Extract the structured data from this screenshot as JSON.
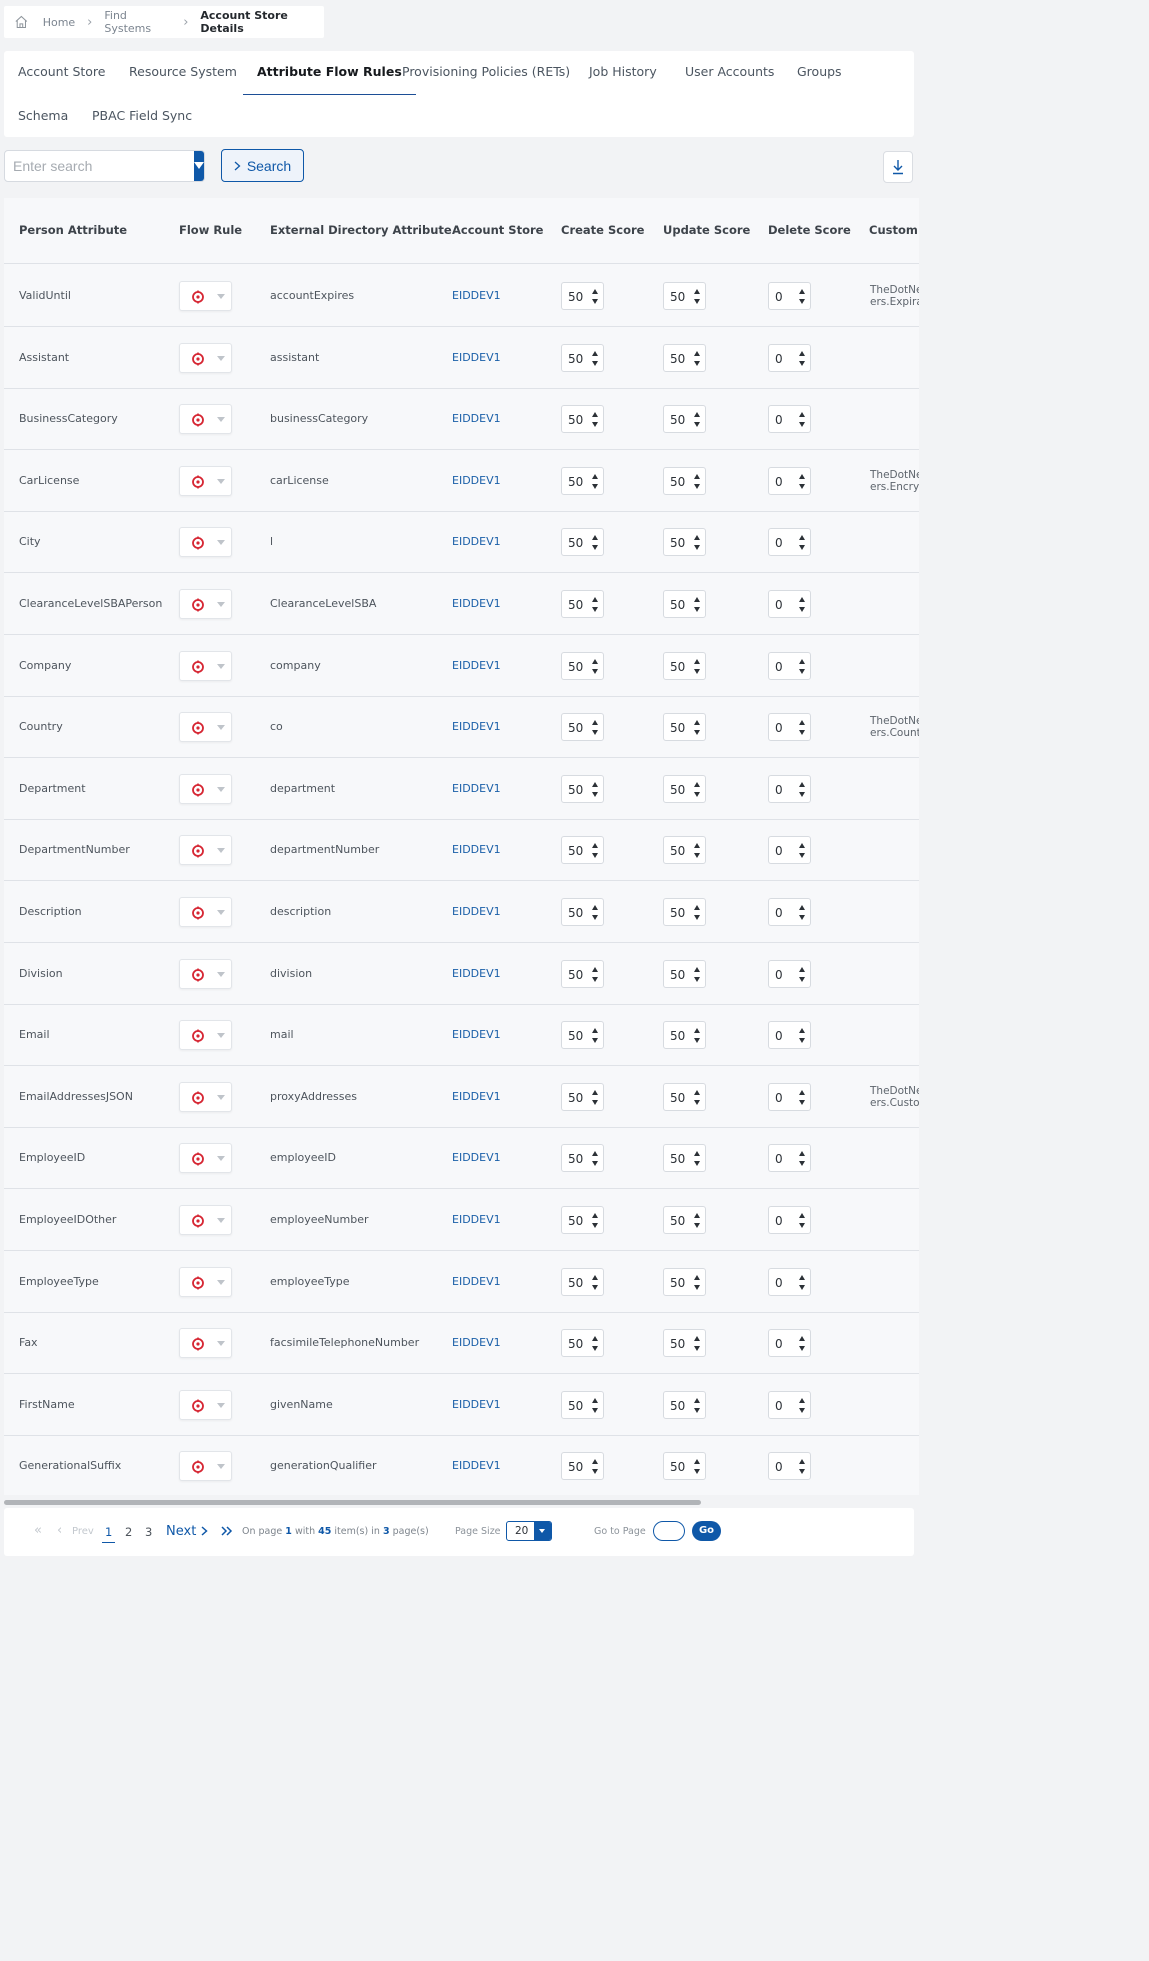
{
  "breadcrumb": {
    "items": [
      "Home",
      "Find Systems",
      "Account Store Details"
    ]
  },
  "tabs": [
    "Account Store",
    "Resource System",
    "Attribute Flow Rules",
    "Provisioning Policies (RETs)",
    "Job History",
    "User Accounts",
    "Groups",
    "Schema",
    "PBAC Field Sync"
  ],
  "active_tab": "Attribute Flow Rules",
  "search": {
    "placeholder": "Enter search",
    "button_label": "Search"
  },
  "table": {
    "columns": [
      "Person Attribute",
      "Flow Rule",
      "External Directory Attribute",
      "Account Store",
      "Create Score",
      "Update Score",
      "Delete Score",
      "Custom"
    ],
    "rows": [
      {
        "person": "ValidUntil",
        "external": "accountExpires",
        "store": "EIDDEV1",
        "create": "50",
        "update": "50",
        "delete": "0",
        "custom": [
          "TheDotNe",
          "ers.Expira"
        ]
      },
      {
        "person": "Assistant",
        "external": "assistant",
        "store": "EIDDEV1",
        "create": "50",
        "update": "50",
        "delete": "0",
        "custom": []
      },
      {
        "person": "BusinessCategory",
        "external": "businessCategory",
        "store": "EIDDEV1",
        "create": "50",
        "update": "50",
        "delete": "0",
        "custom": []
      },
      {
        "person": "CarLicense",
        "external": "carLicense",
        "store": "EIDDEV1",
        "create": "50",
        "update": "50",
        "delete": "0",
        "custom": [
          "TheDotNe",
          "ers.Encryp"
        ]
      },
      {
        "person": "City",
        "external": "l",
        "store": "EIDDEV1",
        "create": "50",
        "update": "50",
        "delete": "0",
        "custom": []
      },
      {
        "person": "ClearanceLevelSBAPerson",
        "external": "ClearanceLevelSBA",
        "store": "EIDDEV1",
        "create": "50",
        "update": "50",
        "delete": "0",
        "custom": []
      },
      {
        "person": "Company",
        "external": "company",
        "store": "EIDDEV1",
        "create": "50",
        "update": "50",
        "delete": "0",
        "custom": []
      },
      {
        "person": "Country",
        "external": "co",
        "store": "EIDDEV1",
        "create": "50",
        "update": "50",
        "delete": "0",
        "custom": [
          "TheDotNe",
          "ers.Count"
        ]
      },
      {
        "person": "Department",
        "external": "department",
        "store": "EIDDEV1",
        "create": "50",
        "update": "50",
        "delete": "0",
        "custom": []
      },
      {
        "person": "DepartmentNumber",
        "external": "departmentNumber",
        "store": "EIDDEV1",
        "create": "50",
        "update": "50",
        "delete": "0",
        "custom": []
      },
      {
        "person": "Description",
        "external": "description",
        "store": "EIDDEV1",
        "create": "50",
        "update": "50",
        "delete": "0",
        "custom": []
      },
      {
        "person": "Division",
        "external": "division",
        "store": "EIDDEV1",
        "create": "50",
        "update": "50",
        "delete": "0",
        "custom": []
      },
      {
        "person": "Email",
        "external": "mail",
        "store": "EIDDEV1",
        "create": "50",
        "update": "50",
        "delete": "0",
        "custom": []
      },
      {
        "person": "EmailAddressesJSON",
        "external": "proxyAddresses",
        "store": "EIDDEV1",
        "create": "50",
        "update": "50",
        "delete": "0",
        "custom": [
          "TheDotNe",
          "ers.Custo"
        ]
      },
      {
        "person": "EmployeeID",
        "external": "employeeID",
        "store": "EIDDEV1",
        "create": "50",
        "update": "50",
        "delete": "0",
        "custom": []
      },
      {
        "person": "EmployeeIDOther",
        "external": "employeeNumber",
        "store": "EIDDEV1",
        "create": "50",
        "update": "50",
        "delete": "0",
        "custom": []
      },
      {
        "person": "EmployeeType",
        "external": "employeeType",
        "store": "EIDDEV1",
        "create": "50",
        "update": "50",
        "delete": "0",
        "custom": []
      },
      {
        "person": "Fax",
        "external": "facsimileTelephoneNumber",
        "store": "EIDDEV1",
        "create": "50",
        "update": "50",
        "delete": "0",
        "custom": []
      },
      {
        "person": "FirstName",
        "external": "givenName",
        "store": "EIDDEV1",
        "create": "50",
        "update": "50",
        "delete": "0",
        "custom": []
      },
      {
        "person": "GenerationalSuffix",
        "external": "generationQualifier",
        "store": "EIDDEV1",
        "create": "50",
        "update": "50",
        "delete": "0",
        "custom": []
      }
    ]
  },
  "pager": {
    "prev_label": "Prev",
    "pages": [
      "1",
      "2",
      "3"
    ],
    "current_page": "1",
    "next_label": "Next",
    "info_prefix": "On page",
    "info_with": "with",
    "info_items": "item(s) in",
    "info_pages": "page(s)",
    "total_items": "45",
    "total_pages": "3",
    "page_size_label": "Page Size",
    "page_size": "20",
    "go_to_page_label": "Go to Page",
    "go_label": "Go"
  },
  "colors": {
    "accent": "#0f58a8",
    "flow_icon": "#d62633",
    "link": "#1a5fa8"
  }
}
